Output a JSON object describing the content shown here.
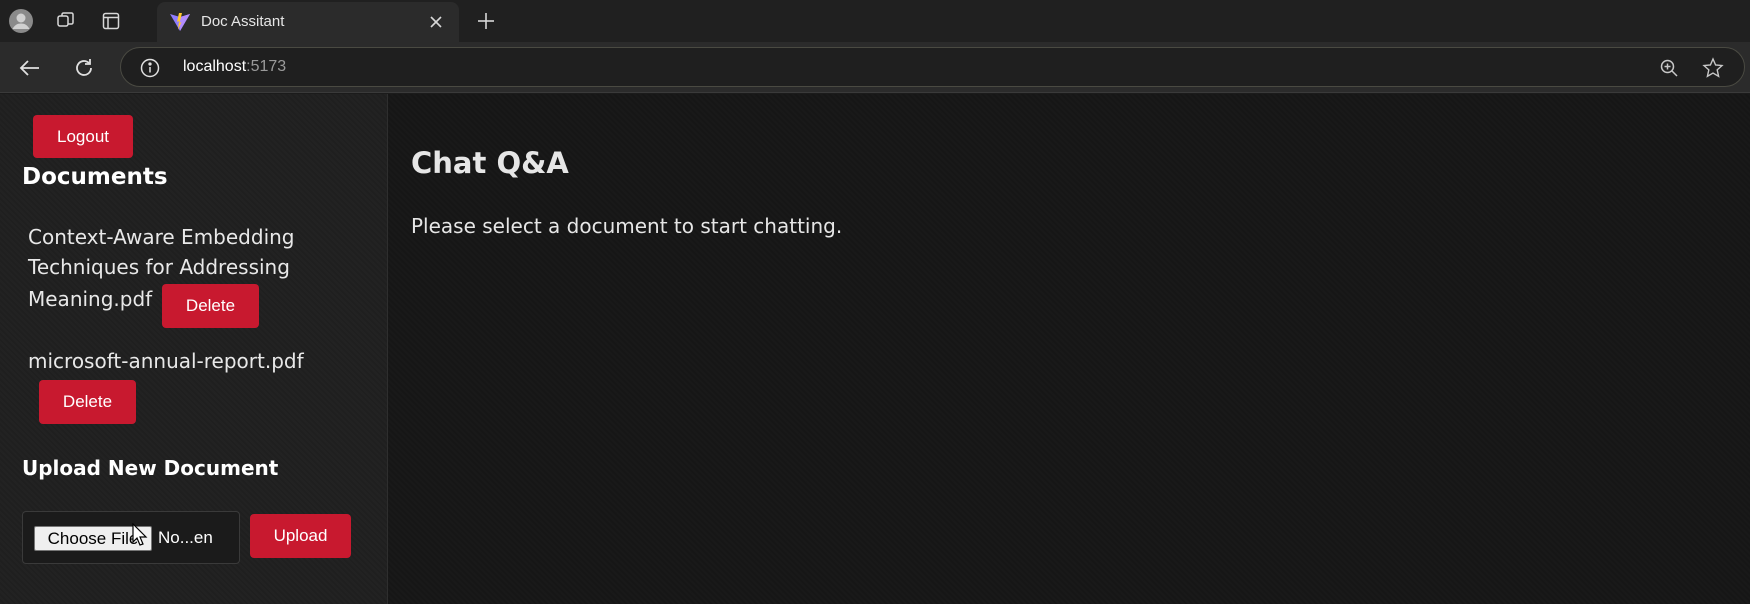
{
  "browser": {
    "tab_title": "Doc Assitant",
    "url_host": "localhost",
    "url_port": ":5173",
    "icons": [
      "profile-icon",
      "workspaces-icon",
      "tab-actions-icon",
      "vite-favicon-icon",
      "close-icon",
      "new-tab-icon",
      "back-icon",
      "refresh-icon",
      "info-icon",
      "zoom-icon",
      "favorite-star-icon"
    ]
  },
  "sidebar": {
    "logout_label": "Logout",
    "documents_heading": "Documents",
    "documents": [
      {
        "name_lines": [
          "Context-Aware Embedding",
          "Techniques for Addressing",
          "Meaning.pdf"
        ],
        "delete_label": "Delete"
      },
      {
        "name_lines": [
          "microsoft-annual-report.pdf"
        ],
        "delete_label": "Delete"
      }
    ],
    "upload": {
      "heading": "Upload New Document",
      "choose_label": "Choose File",
      "file_status": "No...en",
      "upload_label": "Upload"
    }
  },
  "main": {
    "title": "Chat Q&A",
    "hint": "Please select a document to start chatting."
  },
  "colors": {
    "accent_red": "#c8192f",
    "page_bg": "#161616",
    "sidebar_bg": "#1f1f1f"
  }
}
